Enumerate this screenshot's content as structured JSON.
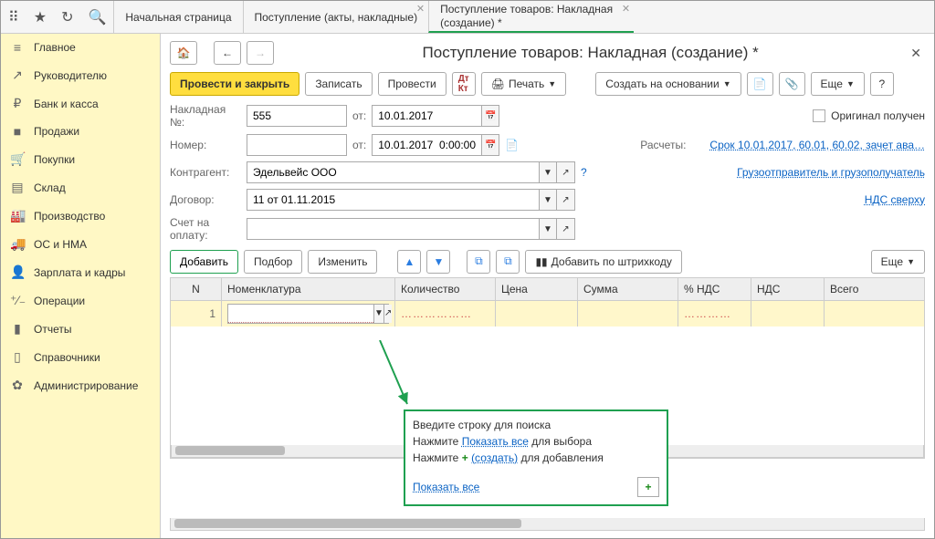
{
  "topbar": {
    "icons": [
      "apps",
      "star",
      "history",
      "search"
    ]
  },
  "tabs": [
    {
      "label": "Начальная страница",
      "closable": false
    },
    {
      "label": "Поступление (акты, накладные)",
      "closable": true
    },
    {
      "label": "Поступление товаров: Накладная (создание) *",
      "closable": true,
      "active": true
    }
  ],
  "sidebar": {
    "items": [
      {
        "label": "Главное",
        "icon": "≡"
      },
      {
        "label": "Руководителю",
        "icon": "↗"
      },
      {
        "label": "Банк и касса",
        "icon": "₽"
      },
      {
        "label": "Продажи",
        "icon": "■"
      },
      {
        "label": "Покупки",
        "icon": "🛒"
      },
      {
        "label": "Склад",
        "icon": "▤"
      },
      {
        "label": "Производство",
        "icon": "🏭"
      },
      {
        "label": "ОС и НМА",
        "icon": "🚚"
      },
      {
        "label": "Зарплата и кадры",
        "icon": "👤"
      },
      {
        "label": "Операции",
        "icon": "⁺⁄₋"
      },
      {
        "label": "Отчеты",
        "icon": "▮"
      },
      {
        "label": "Справочники",
        "icon": "▯"
      },
      {
        "label": "Администрирование",
        "icon": "✿"
      }
    ]
  },
  "page": {
    "title": "Поступление товаров: Накладная (создание) *",
    "toolbar": {
      "post_close": "Провести и закрыть",
      "save": "Записать",
      "post": "Провести",
      "print": "Печать",
      "create_based": "Создать на основании",
      "more": "Еще",
      "help": "?"
    },
    "fields": {
      "invoice_no_label": "Накладная №:",
      "invoice_no": "555",
      "from_label": "от:",
      "invoice_date": "10.01.2017",
      "original_label": "Оригинал получен",
      "number_label": "Номер:",
      "number": "",
      "number_date": "10.01.2017  0:00:00",
      "calc_label": "Расчеты:",
      "calc_link": "Срок 10.01.2017, 60.01, 60.02, зачет ава…",
      "counterparty_label": "Контрагент:",
      "counterparty": "Эдельвейс ООО",
      "shipper_link": "Грузоотправитель и грузополучатель",
      "contract_label": "Договор:",
      "contract": "11 от 01.11.2015",
      "vat_link": "НДС сверху",
      "payacc_label": "Счет на оплату:",
      "payacc": ""
    },
    "grid_toolbar": {
      "add": "Добавить",
      "pick": "Подбор",
      "edit": "Изменить",
      "barcode": "Добавить по штрихкоду",
      "more": "Еще"
    },
    "grid": {
      "headers": [
        "N",
        "Номенклатура",
        "Количество",
        "Цена",
        "Сумма",
        "% НДС",
        "НДС",
        "Всего"
      ],
      "rows": [
        {
          "n": "1",
          "nomenclature": ""
        }
      ]
    },
    "popup": {
      "line1": "Введите строку для поиска",
      "line2a": "Нажмите ",
      "line2_link": "Показать все",
      "line2b": " для выбора",
      "line3a": "Нажмите ",
      "line3_link": "(создать)",
      "line3b": " для добавления",
      "show_all": "Показать все"
    }
  }
}
